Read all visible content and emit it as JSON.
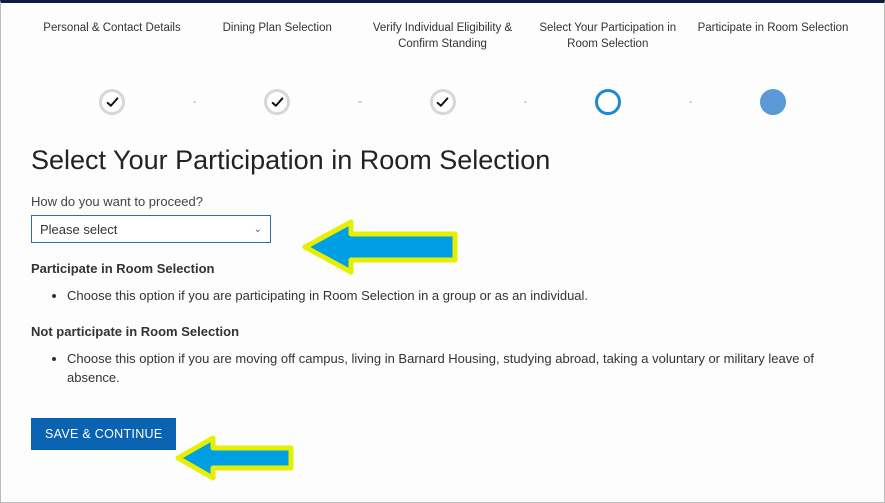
{
  "stepper": {
    "steps": [
      {
        "label": "Personal & Contact Details",
        "state": "done"
      },
      {
        "label": "Dining Plan Selection",
        "state": "done"
      },
      {
        "label": "Verify Individual Eligibility & Confirm Standing",
        "state": "done"
      },
      {
        "label": "Select Your Participation in Room Selection",
        "state": "ring"
      },
      {
        "label": "Participate in Room Selection",
        "state": "solid"
      }
    ]
  },
  "page": {
    "title": "Select Your Participation in Room Selection"
  },
  "form": {
    "question_label": "How do you want to proceed?",
    "select_placeholder": "Please select"
  },
  "option_a": {
    "title": "Participate in Room Selection",
    "bullet": "Choose this option if you are participating in Room Selection in a group or as an individual."
  },
  "option_b": {
    "title": "Not participate in Room Selection",
    "bullet": "Choose this option if you are moving off campus, living in Barnard Housing, studying abroad, taking a voluntary or military leave of absence."
  },
  "save_label": "SAVE & CONTINUE",
  "annotations": {
    "arrow_1": "arrow-pointing-select",
    "arrow_2": "arrow-pointing-save"
  }
}
